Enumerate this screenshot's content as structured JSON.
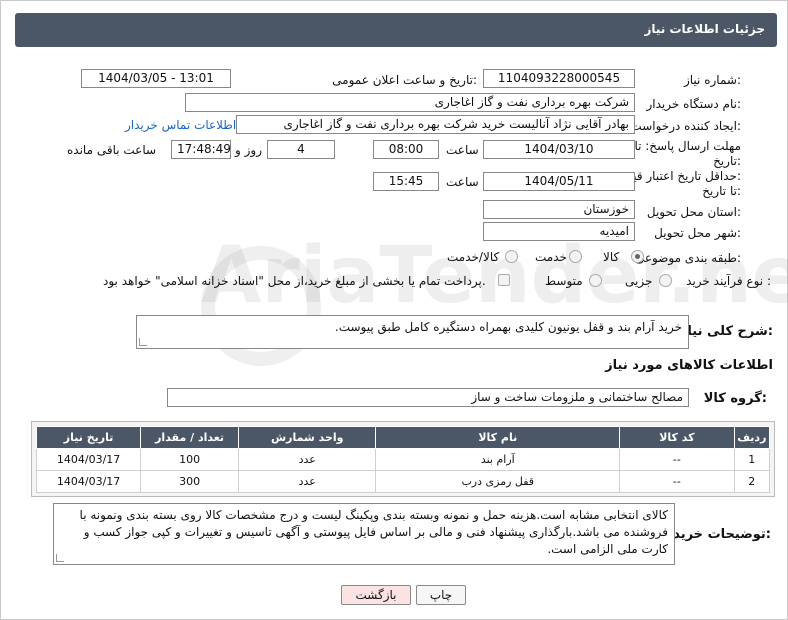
{
  "header": {
    "title": "جزئیات اطلاعات نیاز"
  },
  "fields": {
    "need_number": {
      "label": "شماره نیاز:",
      "value": "1104093228000545"
    },
    "announce_datetime": {
      "label": "تاریخ و ساعت اعلان عمومی:",
      "value": "1404/03/05 - 13:01"
    },
    "buyer_org": {
      "label": "نام دستگاه خریدار:",
      "value": "شرکت بهره برداری نفت و گاز اغاجاری"
    },
    "requester": {
      "label": "ایجاد کننده درخواست:",
      "value": "بهادر  آقایی نژاد آنالیست خرید شرکت بهره برداری نفت و گاز اغاجاری",
      "contact_link": "اطلاعات تماس خریدار"
    },
    "deadline": {
      "label_line1": "مهلت ارسال پاسخ: تا",
      "label_line2": "تاریخ:",
      "date": "1404/03/10",
      "time_label": "ساعت",
      "time": "08:00",
      "days": "4",
      "days_label": "روز و",
      "remaining": "17:48:49",
      "remaining_label": "ساعت باقی مانده"
    },
    "price_validity": {
      "label_line1": "حداقل تاریخ اعتبار قیمت:",
      "label_line2": "تا تاریخ:",
      "date": "1404/05/11",
      "time_label": "ساعت",
      "time": "15:45"
    },
    "province": {
      "label": "استان محل تحویل:",
      "value": "خوزستان"
    },
    "city": {
      "label": "شهر محل تحویل:",
      "value": "امیدیه"
    },
    "category": {
      "label": "طبقه بندی موضوعی:",
      "options": [
        "کالا",
        "خدمت",
        "کالا/خدمت"
      ],
      "selected": "کالا"
    },
    "purchase_type": {
      "label": "نوع فرآیند خرید :",
      "options": [
        "جزیی",
        "متوسط"
      ],
      "selected": "",
      "note": "پرداخت تمام یا بخشی از مبلغ خرید،از محل \"اسناد خزانه اسلامی\" خواهد بود."
    }
  },
  "summary": {
    "label": "شرح کلی نیاز:",
    "value": "خرید  آرام بند و قفل یونیون کلیدی بهمراه دستگیره کامل طبق پیوست."
  },
  "goods_section": {
    "title": "اطلاعات کالاهای مورد نیاز",
    "group_label": "گروه کالا:",
    "group_value": "مصالح ساختمانی و ملزومات ساخت و ساز"
  },
  "table": {
    "headers": [
      "ردیف",
      "کد کالا",
      "نام کالا",
      "واحد شمارش",
      "تعداد / مقدار",
      "تاریخ نیاز"
    ],
    "rows": [
      [
        "1",
        "--",
        "آرام بند",
        "عدد",
        "100",
        "1404/03/17"
      ],
      [
        "2",
        "--",
        "قفل رمزی درب",
        "عدد",
        "300",
        "1404/03/17"
      ]
    ]
  },
  "buyer_notes": {
    "label": "توضیحات خریدار:",
    "value": "کالای انتخابی مشابه است.هزینه حمل و نمونه وبسته بندی وپکینگ لیست و درج مشخصات کالا روی بسته بندی ونمونه  با فروشنده می باشد.بارگذاری پیشنهاد فنی و مالی بر اساس فایل پیوستی و  آگهی تاسیس و تغییرات و کپی جواز کسب و کارت ملی الزامی است."
  },
  "buttons": {
    "print": "چاپ",
    "back": "بازگشت"
  },
  "watermark": {
    "text": "AriaTender.net"
  },
  "colors": {
    "header_bg": "#4b5767",
    "link": "#1a66c9",
    "back_btn_bg": "#fbe3e3"
  }
}
